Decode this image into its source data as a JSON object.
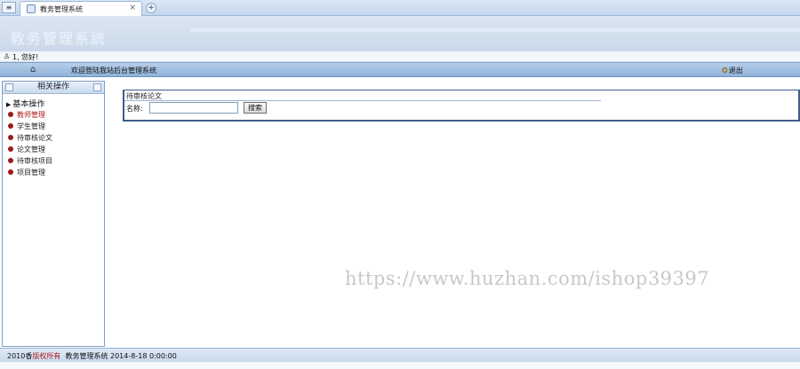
{
  "browser": {
    "tab_title": "教务管理系统",
    "tab_close": "×",
    "new_tab": "+"
  },
  "banner": {
    "title": "教务管理系统"
  },
  "userbar": {
    "greeting": "1, 您好!"
  },
  "navbar": {
    "welcome": "欢迎登陆我站后台管理系统",
    "logout": "退出"
  },
  "sidebar": {
    "header": "相关操作",
    "group": "基本操作",
    "items": [
      {
        "label": "教师管理",
        "active": true
      },
      {
        "label": "学生管理"
      },
      {
        "label": "待审核论文"
      },
      {
        "label": "论文管理"
      },
      {
        "label": "待审核项目"
      },
      {
        "label": "项目管理"
      }
    ]
  },
  "panel": {
    "title": "待审核论文",
    "search_label": "名称:",
    "search_value": "",
    "search_button": "搜索"
  },
  "watermark": "https://www.huzhan.com/ishop39397",
  "footer": {
    "year": "2010",
    "copyright": "版权所有",
    "prefix": "香",
    "system_name": "教务管理系统",
    "timestamp": "2014-8-18 0:00:00"
  },
  "colors": {
    "nav_blue": "#8fb2d9",
    "panel_border": "#3d5f8a",
    "active_red": "#b21b1b"
  }
}
